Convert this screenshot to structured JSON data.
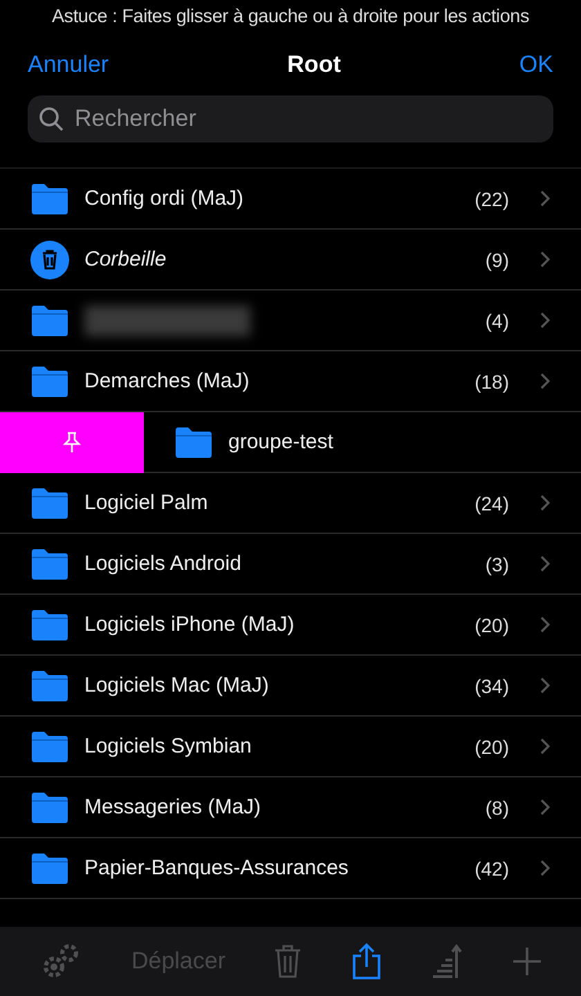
{
  "hint": "Astuce : Faites glisser à gauche ou à droite pour les actions",
  "nav": {
    "cancel": "Annuler",
    "title": "Root",
    "confirm": "OK"
  },
  "search": {
    "placeholder": "Rechercher"
  },
  "rows": [
    {
      "kind": "folder",
      "label": "Config ordi (MaJ)",
      "count": "(22)",
      "swiped": false,
      "redacted": false
    },
    {
      "kind": "trash",
      "label": "Corbeille",
      "count": "(9)",
      "swiped": false,
      "redacted": false
    },
    {
      "kind": "folder",
      "count": "(4)",
      "swiped": false,
      "redacted": true
    },
    {
      "kind": "folder",
      "label": "Demarches (MaJ)",
      "count": "(18)",
      "swiped": false,
      "redacted": false
    },
    {
      "kind": "folder",
      "label": "groupe-test",
      "swiped": true,
      "redacted": false
    },
    {
      "kind": "folder",
      "label": "Logiciel Palm",
      "count": "(24)",
      "swiped": false,
      "redacted": false
    },
    {
      "kind": "folder",
      "label": "Logiciels Android",
      "count": "(3)",
      "swiped": false,
      "redacted": false
    },
    {
      "kind": "folder",
      "label": "Logiciels iPhone (MaJ)",
      "count": "(20)",
      "swiped": false,
      "redacted": false
    },
    {
      "kind": "folder",
      "label": "Logiciels Mac (MaJ)",
      "count": "(34)",
      "swiped": false,
      "redacted": false
    },
    {
      "kind": "folder",
      "label": "Logiciels Symbian",
      "count": "(20)",
      "swiped": false,
      "redacted": false
    },
    {
      "kind": "folder",
      "label": "Messageries (MaJ)",
      "count": "(8)",
      "swiped": false,
      "redacted": false
    },
    {
      "kind": "folder",
      "label": "Papier-Banques-Assurances",
      "count": "(42)",
      "swiped": false,
      "redacted": false
    }
  ],
  "toolbar": [
    {
      "kind": "settings",
      "disabled": true
    },
    {
      "kind": "move",
      "label": "Déplacer",
      "disabled": true
    },
    {
      "kind": "delete",
      "disabled": true
    },
    {
      "kind": "share",
      "disabled": false
    },
    {
      "kind": "sort",
      "disabled": true
    },
    {
      "kind": "add",
      "disabled": true
    }
  ]
}
